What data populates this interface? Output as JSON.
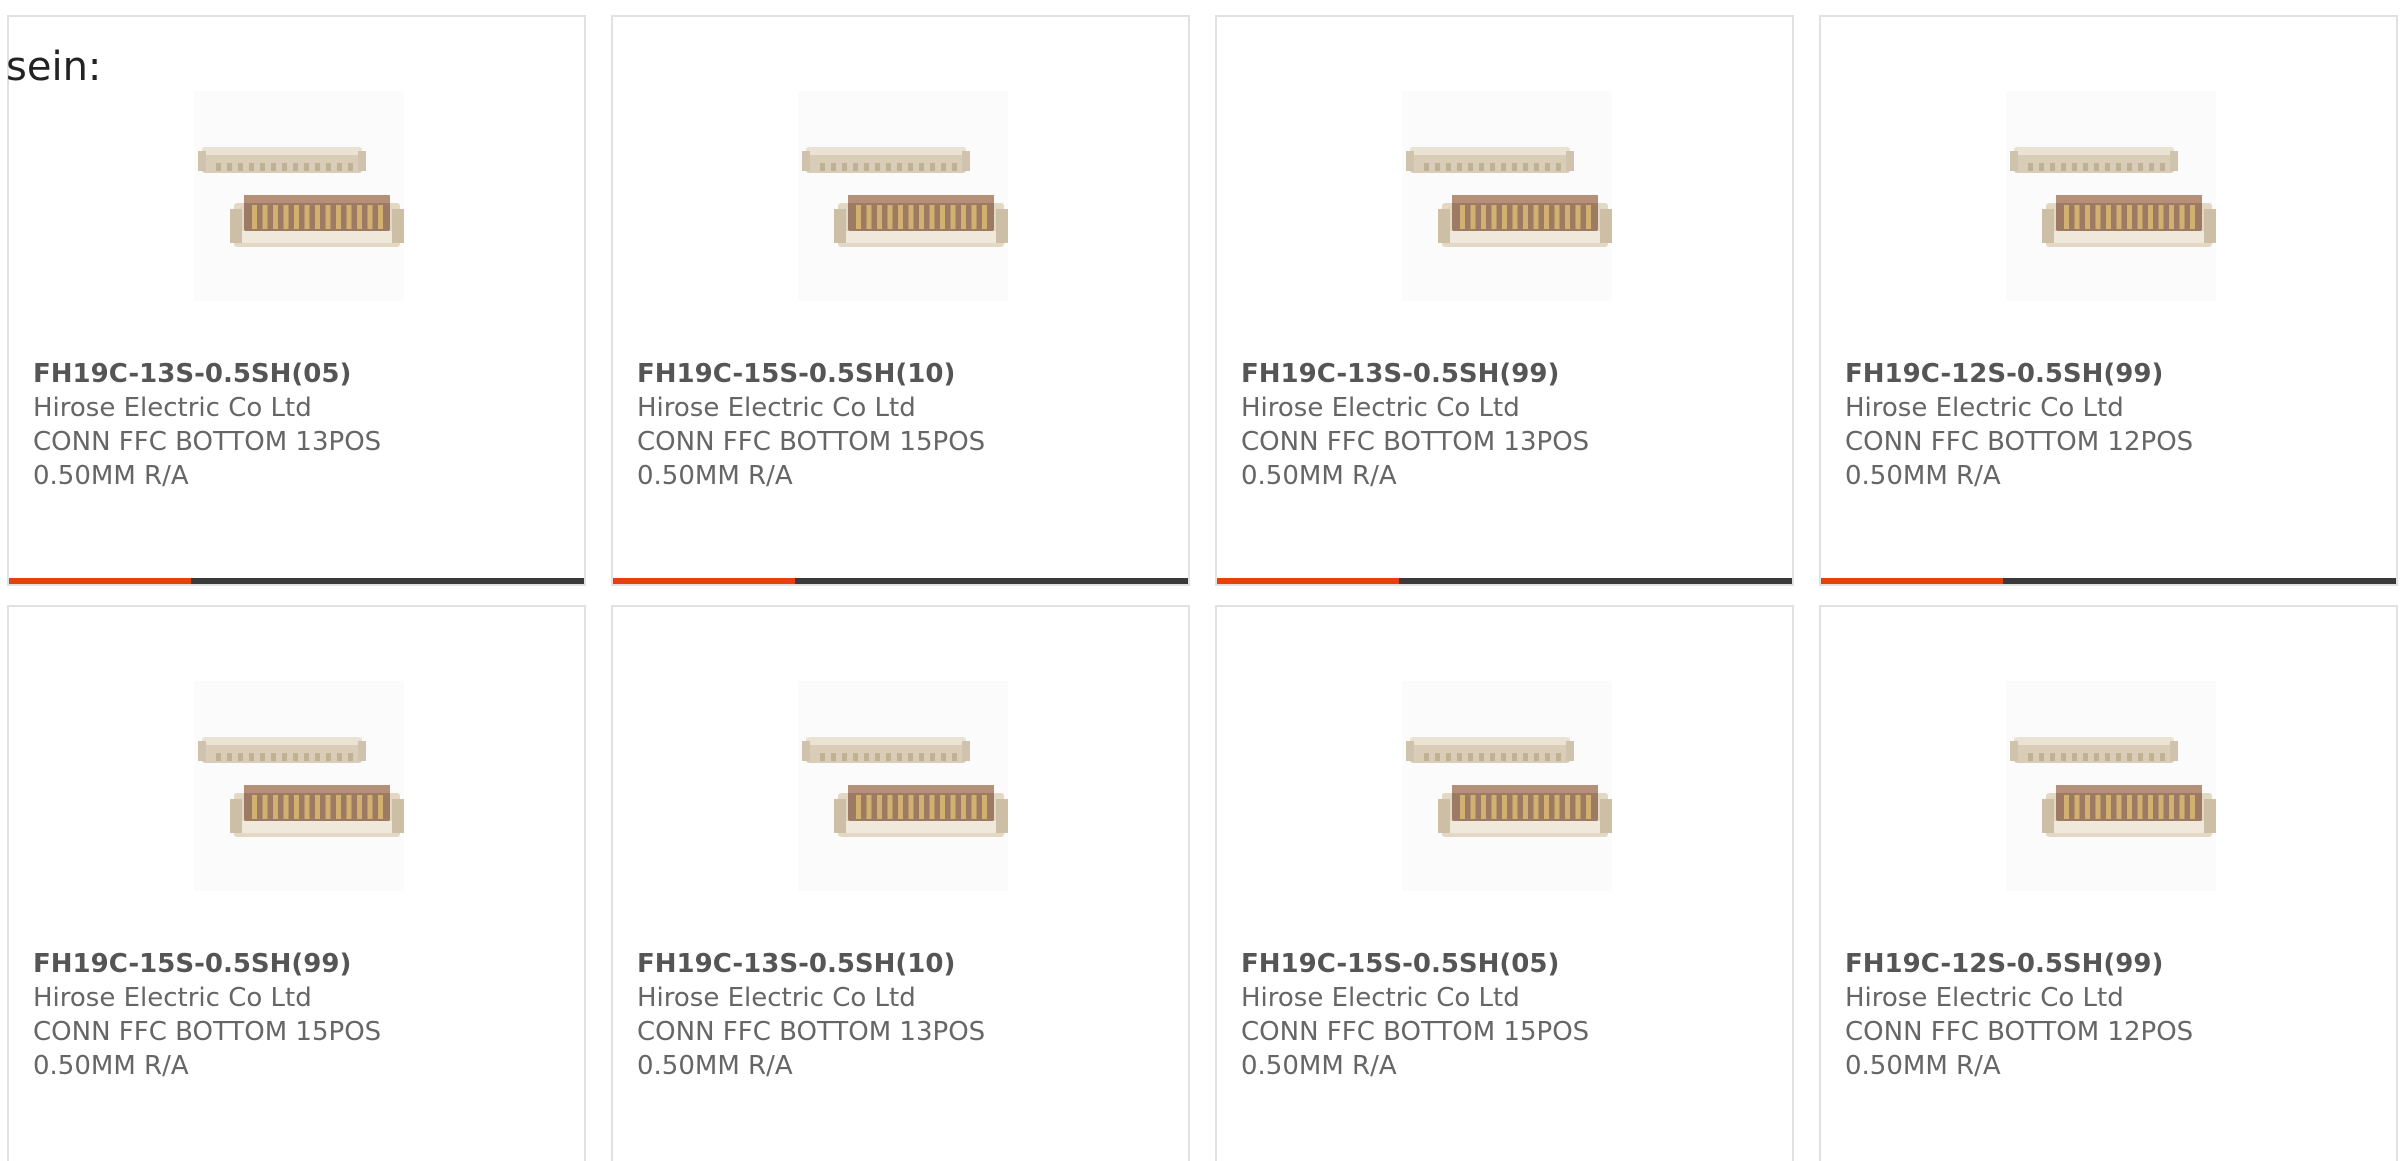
{
  "intro": {
    "text": "sein:"
  },
  "products": [
    {
      "part": "FH19C-13S-0.5SH(05)",
      "maker": "Hirose Electric Co Ltd",
      "desc1": "CONN FFC BOTTOM 13POS",
      "desc2": "0.50MM R/A"
    },
    {
      "part": "FH19C-15S-0.5SH(10)",
      "maker": "Hirose Electric Co Ltd",
      "desc1": "CONN FFC BOTTOM 15POS",
      "desc2": "0.50MM R/A"
    },
    {
      "part": "FH19C-13S-0.5SH(99)",
      "maker": "Hirose Electric Co Ltd",
      "desc1": "CONN FFC BOTTOM 13POS",
      "desc2": "0.50MM R/A"
    },
    {
      "part": "FH19C-12S-0.5SH(99)",
      "maker": "Hirose Electric Co Ltd",
      "desc1": "CONN FFC BOTTOM 12POS",
      "desc2": "0.50MM R/A"
    },
    {
      "part": "FH19C-15S-0.5SH(99)",
      "maker": "Hirose Electric Co Ltd",
      "desc1": "CONN FFC BOTTOM 15POS",
      "desc2": "0.50MM R/A"
    },
    {
      "part": "FH19C-13S-0.5SH(10)",
      "maker": "Hirose Electric Co Ltd",
      "desc1": "CONN FFC BOTTOM 13POS",
      "desc2": "0.50MM R/A"
    },
    {
      "part": "FH19C-15S-0.5SH(05)",
      "maker": "Hirose Electric Co Ltd",
      "desc1": "CONN FFC BOTTOM 15POS",
      "desc2": "0.50MM R/A"
    },
    {
      "part": "FH19C-12S-0.5SH(99)",
      "maker": "Hirose Electric Co Ltd",
      "desc1": "CONN FFC BOTTOM 12POS",
      "desc2": "0.50MM R/A"
    }
  ],
  "colors": {
    "accent": "#e8400c",
    "bar": "#3a3a3a",
    "card_border": "#e1e1e1",
    "text": "#666666"
  }
}
